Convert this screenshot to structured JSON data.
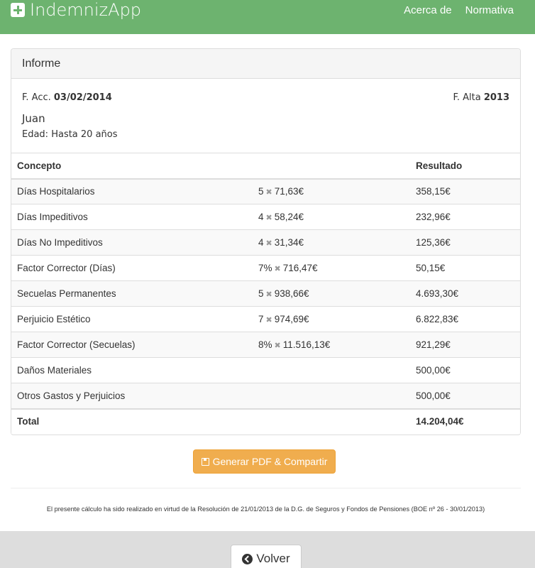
{
  "navbar": {
    "brand": "IndemnizApp",
    "links": [
      "Acerca de",
      "Normativa"
    ]
  },
  "panel": {
    "heading": "Informe",
    "f_acc_label": "F. Acc.",
    "f_acc_value": "03/02/2014",
    "f_alta_label": "F. Alta",
    "f_alta_value": "2013",
    "name": "Juan",
    "edad": "Edad: Hasta 20 años"
  },
  "table": {
    "headers": {
      "concepto": "Concepto",
      "calculo": "",
      "resultado": "Resultado"
    },
    "rows": [
      {
        "concepto": "Días Hospitalarios",
        "qty": "5",
        "unit": "71,63€",
        "resultado": "358,15€"
      },
      {
        "concepto": "Días Impeditivos",
        "qty": "4",
        "unit": "58,24€",
        "resultado": "232,96€"
      },
      {
        "concepto": "Días No Impeditivos",
        "qty": "4",
        "unit": "31,34€",
        "resultado": "125,36€"
      },
      {
        "concepto": "Factor Corrector (Días)",
        "qty": "7%",
        "unit": "716,47€",
        "resultado": "50,15€"
      },
      {
        "concepto": "Secuelas Permanentes",
        "qty": "5",
        "unit": "938,66€",
        "resultado": "4.693,30€"
      },
      {
        "concepto": "Perjuicio Estético",
        "qty": "7",
        "unit": "974,69€",
        "resultado": "6.822,83€"
      },
      {
        "concepto": "Factor Corrector (Secuelas)",
        "qty": "8%",
        "unit": "11.516,13€",
        "resultado": "921,29€"
      },
      {
        "concepto": "Daños Materiales",
        "qty": "",
        "unit": "",
        "resultado": "500,00€"
      },
      {
        "concepto": "Otros Gastos y Perjuicios",
        "qty": "",
        "unit": "",
        "resultado": "500,00€"
      }
    ],
    "total_label": "Total",
    "total_value": "14.204,04€"
  },
  "pdf_button": "Generar PDF & Compartir",
  "footnote": "El presente cálculo ha sido realizado en virtud de la Resolución de 21/01/2013 de la D.G. de Seguros y Fondos de Pensiones (BOE nº 26 - 30/01/2013)",
  "back_button": "Volver",
  "icons": {
    "brand": "plus-square-icon",
    "pdf": "floppy-disk-icon",
    "back": "circle-chevron-left-icon",
    "multiply": "times-icon"
  },
  "colors": {
    "navbar": "#6db36f",
    "warning_button": "#f0ad4e",
    "bottom_bar": "#dddddd"
  }
}
